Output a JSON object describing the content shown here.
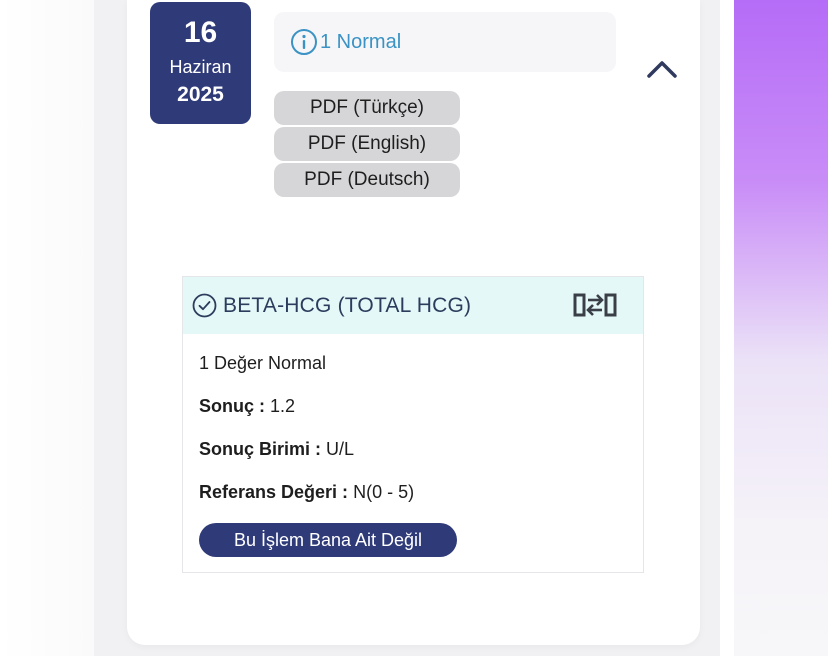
{
  "date": {
    "day": "16",
    "month": "Haziran",
    "year": "2025"
  },
  "status": {
    "icon": "info-circle-icon",
    "text": "1 Normal",
    "color": "#3a93c4"
  },
  "pdf_buttons": [
    "PDF (Türkçe)",
    "PDF (English)",
    "PDF (Deutsch)"
  ],
  "result": {
    "test_name": "BETA-HCG (TOTAL HCG)",
    "summary": "1 Değer Normal",
    "sonuc_label": "Sonuç :",
    "sonuc_value": "1.2",
    "birim_label": "Sonuç Birimi :",
    "birim_value": "U/L",
    "referans_label": "Referans Değeri :",
    "referans_value": "N(0 - 5)",
    "not_mine_button": "Bu İşlem Bana Ait Değil"
  },
  "colors": {
    "brand": "#2f3a78",
    "header_bg": "#e4f8f8",
    "pdf_bg": "#d6d6d8"
  }
}
